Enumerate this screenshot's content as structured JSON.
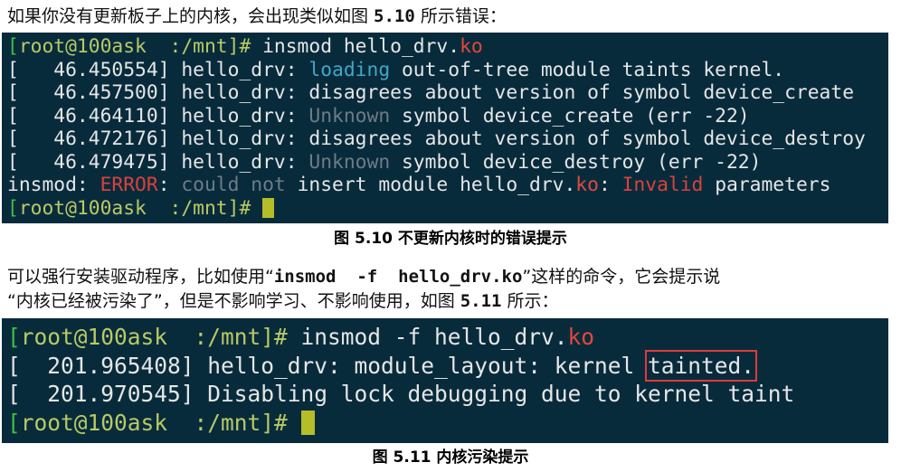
{
  "intro_text": "如果你没有更新板子上的内核，会出现类似如图 ",
  "intro_fig": "5.10",
  "intro_tail": " 所示错误：",
  "terminal1": {
    "prompt": "root@100ask  :/mnt]#",
    "cmd": " insmod hello_drv.",
    "cmd_ext": "ko",
    "lines": [
      {
        "ts": "   46.450554]",
        "mod": " hello_drv: ",
        "hl": "loading",
        "rest": " out-of-tree module taints kernel."
      },
      {
        "ts": "   46.457500]",
        "mod": " hello_drv: ",
        "hl": "",
        "rest": "disagrees about version of symbol device_create"
      },
      {
        "ts": "   46.464110]",
        "mod": " hello_drv: ",
        "hl": "Unknown",
        "rest": " symbol device_create (err -22)"
      },
      {
        "ts": "   46.472176]",
        "mod": " hello_drv: ",
        "hl": "",
        "rest": "disagrees about version of symbol device_destroy"
      },
      {
        "ts": "   46.479475]",
        "mod": " hello_drv: ",
        "hl": "Unknown",
        "rest": " symbol device_destroy (err -22)"
      }
    ],
    "err_prefix": "insmod: ",
    "err_word": "ERROR",
    "err_colon": ": ",
    "err_dim": "could not",
    "err_mid": " insert module hello_drv.",
    "err_ko": "ko",
    "err_colon2": ": ",
    "err_invalid": "Invalid",
    "err_params": " parameters",
    "prompt2": "root@100ask  :/mnt]#"
  },
  "caption1": "图 5.10 不更新内核时的错误提示",
  "para2_line1_pre": "可以强行安装驱动程序，比如使用“",
  "para2_cmd": "insmod  -f  hello_drv.ko",
  "para2_line1_post": "”这样的命令，它会提示说",
  "para2_line2_pre": "“内核已经被污染了”，但是不影响学习、不影响使用，如图 ",
  "para2_fig": "5.11",
  "para2_line2_post": " 所示：",
  "terminal2": {
    "prompt": "root@100ask  :/mnt]#",
    "cmd": " insmod -f hello_drv.",
    "cmd_ext": "ko",
    "line1_ts": "  201.965408]",
    "line1_text": " hello_drv: module_layout: kernel ",
    "line1_box": "tainted.",
    "line2_ts": "  201.970545]",
    "line2_text": " Disabling lock debugging due to kernel taint",
    "prompt2": "root@100ask  :/mnt]#"
  },
  "caption2": "图 5.11 内核污染提示"
}
